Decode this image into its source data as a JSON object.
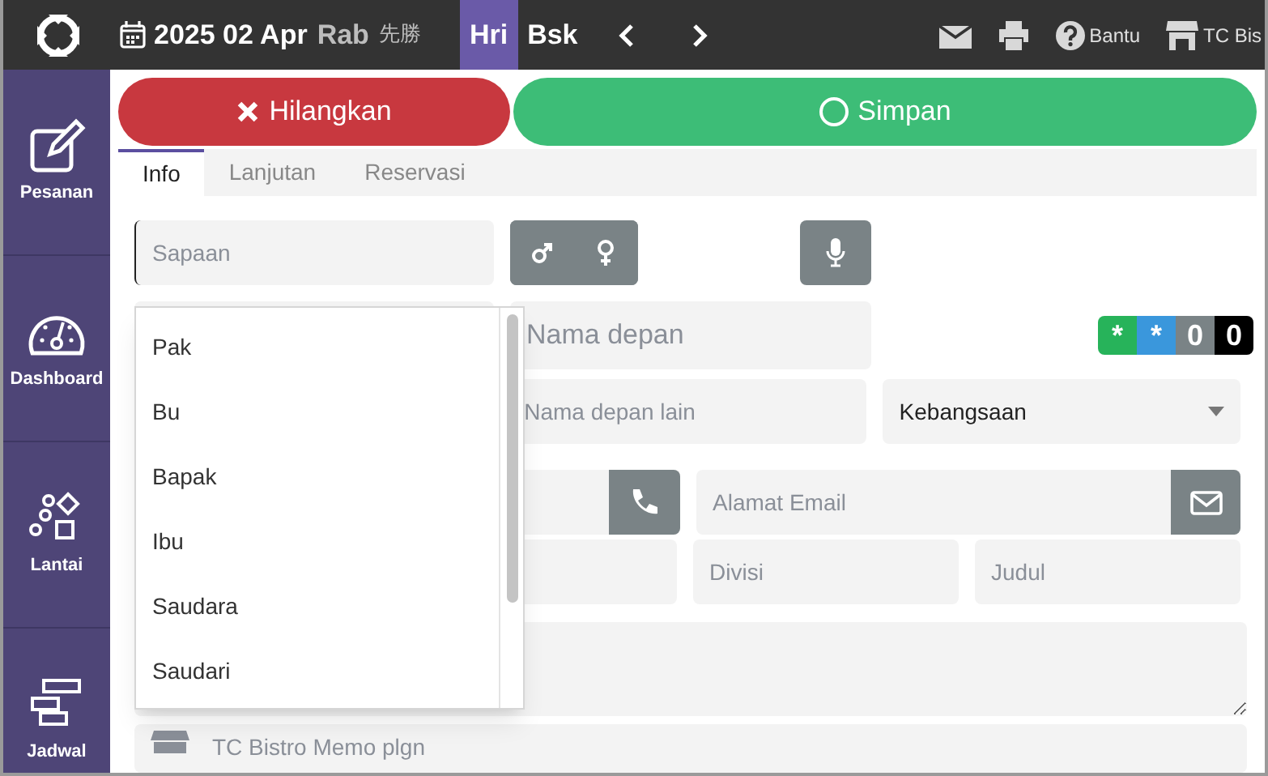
{
  "header": {
    "date": "2025 02 Apr",
    "weekday": "Rab",
    "rokuyo": "先勝",
    "view_tabs": [
      {
        "label": "Hri",
        "selected": true
      },
      {
        "label": "Bsk",
        "selected": false
      }
    ],
    "actions": [
      {
        "kind": "mail"
      },
      {
        "kind": "print"
      },
      {
        "kind": "help",
        "label": "Bantu"
      },
      {
        "kind": "store",
        "label": "TC Bis"
      }
    ]
  },
  "sidebar": {
    "items": [
      {
        "kind": "edit",
        "label": "Pesanan"
      },
      {
        "kind": "gauge",
        "label": "Dashboard"
      },
      {
        "kind": "shapes",
        "label": "Lantai"
      },
      {
        "kind": "schedule",
        "label": "Jadwal"
      }
    ]
  },
  "buttons": [
    {
      "kind": "discard",
      "label": "Hilangkan"
    },
    {
      "kind": "save",
      "label": "Simpan"
    }
  ],
  "tabs": [
    {
      "label": "Info",
      "selected": true
    },
    {
      "label": "Lanjutan",
      "selected": false
    },
    {
      "label": "Reservasi",
      "selected": false
    }
  ],
  "form": {
    "salutation": {
      "placeholder": "Sapaan"
    },
    "first_name": {
      "placeholder": "Nama depan"
    },
    "other_first_name": {
      "placeholder": "Nama depan lain"
    },
    "nationality": {
      "placeholder": "Kebangsaan"
    },
    "email": {
      "placeholder": "Alamat Email"
    },
    "division": {
      "placeholder": "Divisi"
    },
    "job_title": {
      "placeholder": "Judul"
    },
    "memo": {
      "placeholder": "TC Bistro Memo plgn"
    },
    "badges": [
      {
        "label": "*",
        "color": "#27b35a"
      },
      {
        "label": "*",
        "color": "#3a97dc"
      },
      {
        "label": "0",
        "color": "#7a8386"
      },
      {
        "label": "0",
        "color": "#000000"
      }
    ]
  },
  "salutation_dropdown": {
    "items": [
      "Pak",
      "Bu",
      "Bapak",
      "Ibu",
      "Saudara",
      "Saudari"
    ]
  }
}
